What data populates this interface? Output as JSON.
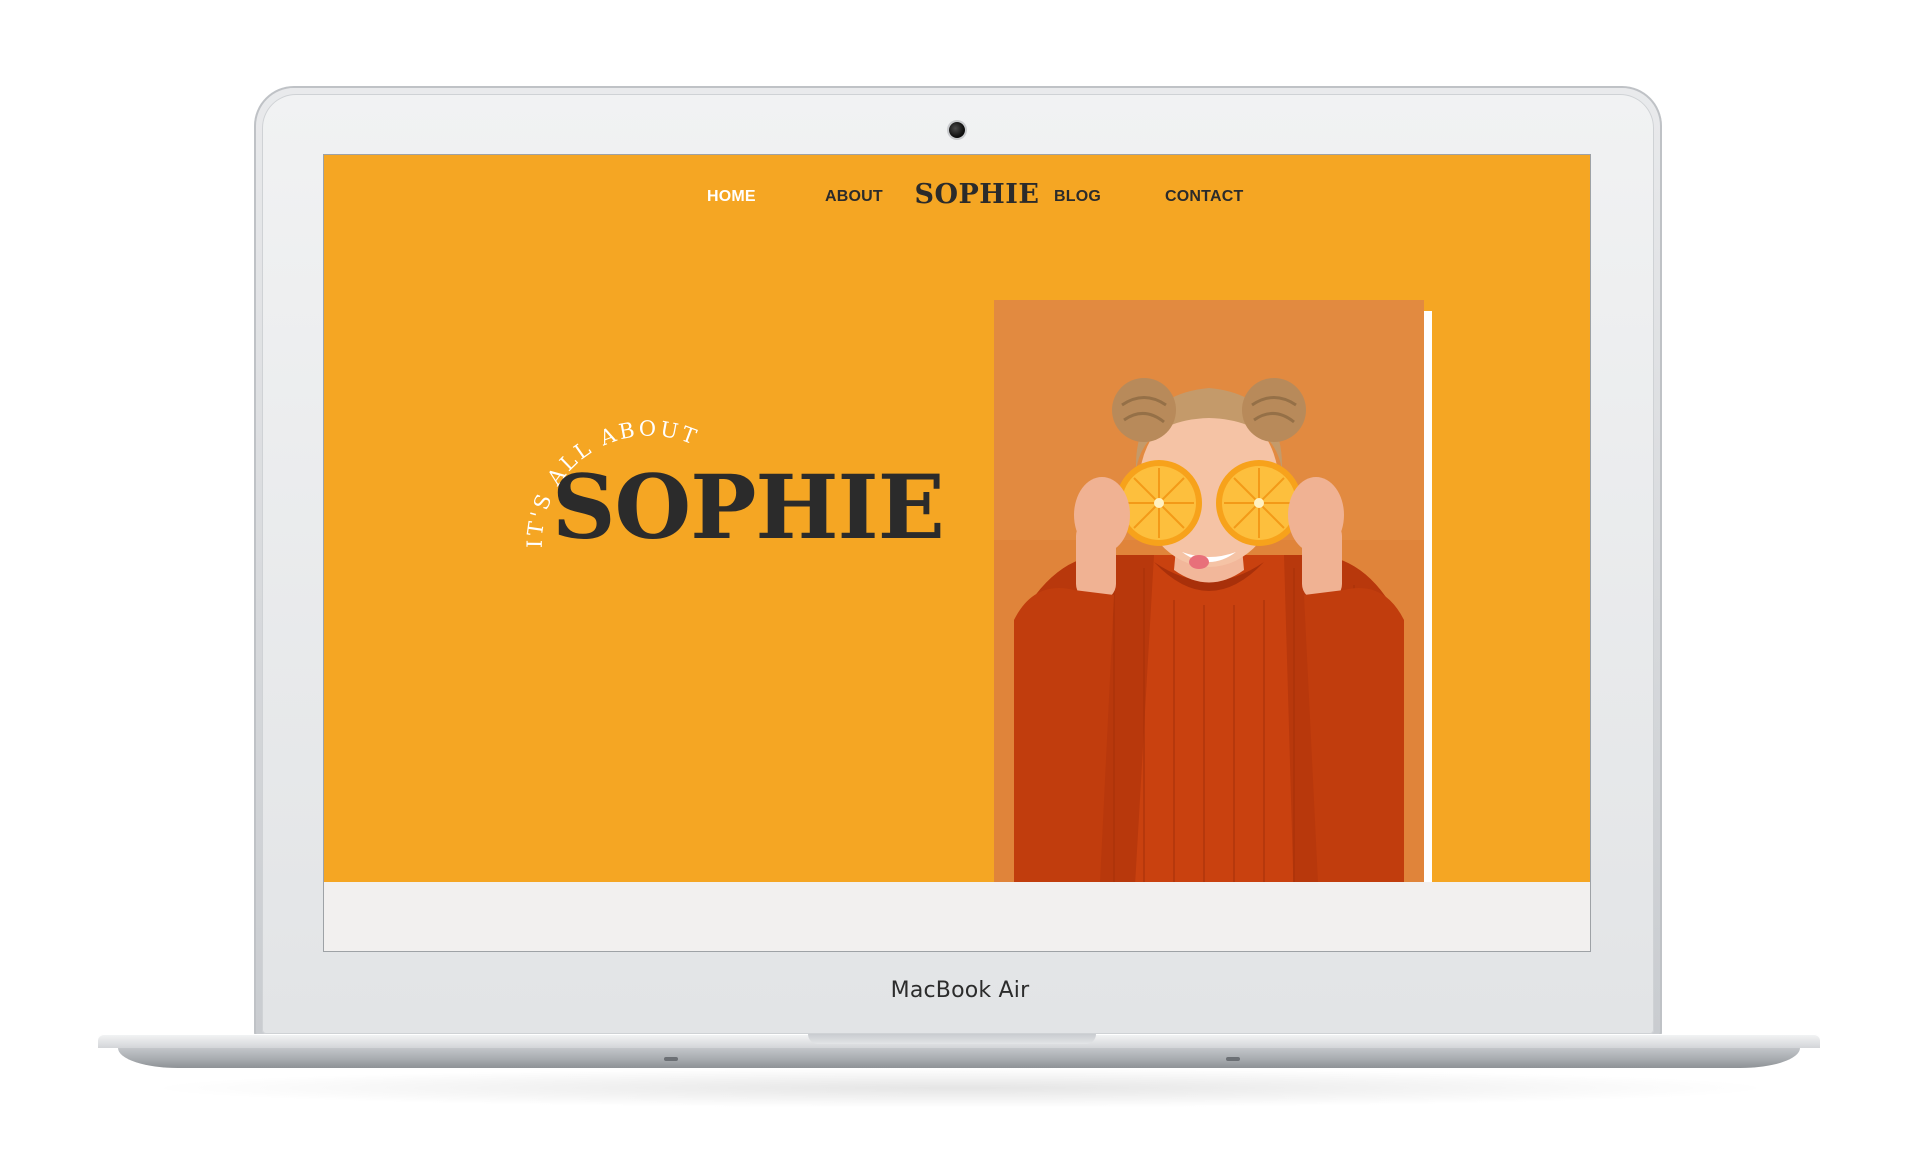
{
  "device": {
    "label": "MacBook Air"
  },
  "site": {
    "nav": {
      "home": "HOME",
      "about": "ABOUT",
      "logo": "SOPHIE",
      "blog": "BLOG",
      "contact": "CONTACT"
    },
    "hero": {
      "arc_text": "IT'S ALL ABOUT",
      "name": "SOPHIE",
      "photo_icon": "portrait-photo-icon"
    }
  },
  "colors": {
    "hero_background": "#f5a623",
    "text_dark": "#2b2b2b",
    "active_nav": "#ffffff",
    "lower_band": "#f2f0ef"
  }
}
